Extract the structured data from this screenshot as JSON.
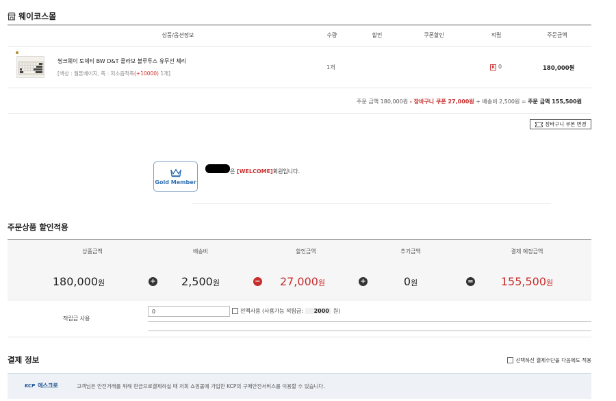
{
  "shop": {
    "title": "웨이코스몰"
  },
  "order_table": {
    "headers": [
      "상품/옵션정보",
      "수량",
      "할인",
      "쿠폰할인",
      "적립",
      "주문금액"
    ],
    "item": {
      "name": "씽크웨이 토체티 BW D&T 콜라보 블루투스 유무선 체리",
      "option_prefix": "[색상 : 웜톤베이지, 축 : 저소음적축",
      "option_extra": "(+10000)",
      "option_suffix": " 1개]",
      "quantity": "1개",
      "points_badge": "R",
      "points": "0",
      "price": "180,000원"
    },
    "summary": {
      "order_amount": "주문 금액 180,000원",
      "coupon": "- 장바구니 쿠폰 27,000원",
      "shipping": "+ 배송비 2,500원 =",
      "total": "주문 금액 155,500원"
    },
    "coupon_button": "장바구니 쿠폰 변경"
  },
  "member": {
    "grade_label": "Gold Member",
    "welcome_prefix": "은 ",
    "grade_tag": "[WELCOME]",
    "welcome_suffix": "회원입니다."
  },
  "discount_section": {
    "title": "주문상품 할인적용",
    "columns": [
      {
        "label": "상품금액",
        "value": "180,000",
        "unit": "원",
        "highlight": false
      },
      {
        "label": "배송비",
        "value": "2,500",
        "unit": "원",
        "highlight": false
      },
      {
        "label": "할인금액",
        "value": "27,000",
        "unit": "원",
        "highlight": true
      },
      {
        "label": "추가금액",
        "value": "0",
        "unit": "원",
        "highlight": false
      },
      {
        "label": "결제 예정금액",
        "value": "155,500",
        "unit": "원",
        "highlight": true
      }
    ],
    "operators": [
      "+",
      "−",
      "+",
      "="
    ],
    "points_label": "적립금 사용",
    "points_input_value": "0",
    "use_all_label": "전액사용 (사용가능 적립금:",
    "available_points": "2000",
    "available_unit": "원)"
  },
  "payment_section": {
    "title": "결제 정보",
    "remember_label": "선택하신 결제수단을 다음에도 적용",
    "escrow_logo": "KCP",
    "escrow_label": "에스크로",
    "escrow_text": "고객님은 안전거래를 위해 현금으로결제하실 때 저희 쇼핑몰에 가입한 KCP의 구매안전서비스를 이용할 수 있습니다."
  },
  "colors": {
    "accent_red": "#c82d2d",
    "member_blue": "#2f6fb0",
    "escrow_blue": "#1d4f91"
  }
}
